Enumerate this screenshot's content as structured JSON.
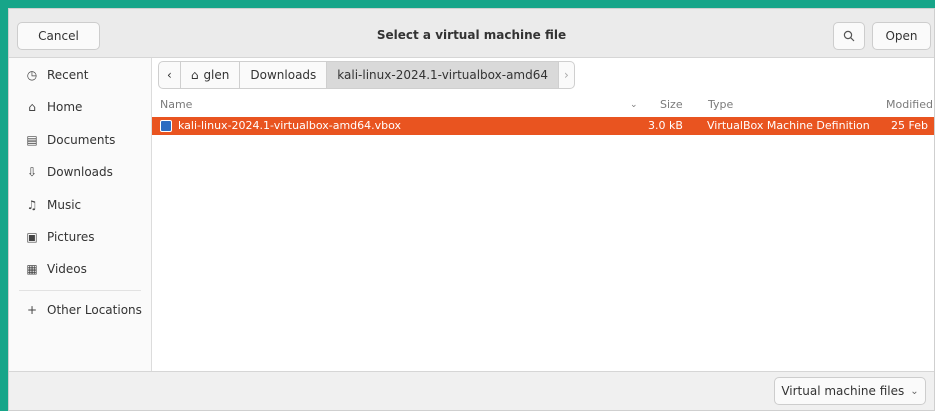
{
  "dialog": {
    "title": "Select a virtual machine file",
    "cancel_label": "Cancel",
    "open_label": "Open",
    "search_icon": "search-icon"
  },
  "sidebar": {
    "items": [
      {
        "label": "Recent",
        "icon": "clock-icon"
      },
      {
        "label": "Home",
        "icon": "home-icon"
      },
      {
        "label": "Documents",
        "icon": "document-icon"
      },
      {
        "label": "Downloads",
        "icon": "download-icon"
      },
      {
        "label": "Music",
        "icon": "music-icon"
      },
      {
        "label": "Pictures",
        "icon": "picture-icon"
      },
      {
        "label": "Videos",
        "icon": "video-icon"
      },
      {
        "label": "Other Locations",
        "icon": "plus-icon"
      }
    ]
  },
  "pathbar": {
    "crumbs": [
      "glen",
      "Downloads",
      "kali-linux-2024.1-virtualbox-amd64"
    ]
  },
  "columns": {
    "name": "Name",
    "size": "Size",
    "type": "Type",
    "modified": "Modified"
  },
  "files": [
    {
      "name": "kali-linux-2024.1-virtualbox-amd64.vbox",
      "size": "3.0 kB",
      "type": "VirtualBox Machine Definition",
      "modified": "25 Feb",
      "selected": true
    }
  ],
  "footer": {
    "filter_label": "Virtual machine files"
  },
  "colors": {
    "accent": "#e95420",
    "background": "#17a589"
  }
}
